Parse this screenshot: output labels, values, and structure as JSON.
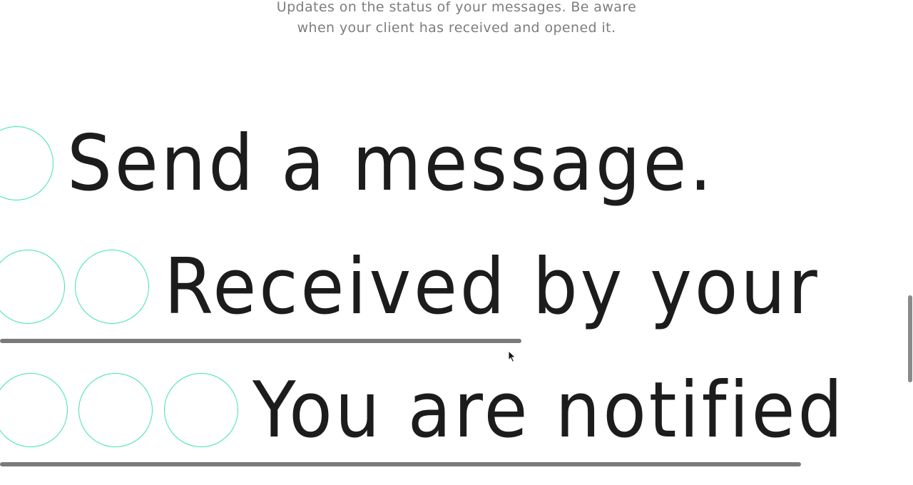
{
  "header": {
    "subtitle_line1": "Updates on the status of your messages. Be aware",
    "subtitle_line2": "when your client has received and opened it."
  },
  "steps": [
    {
      "label": "Send a message.",
      "ring_count": 1
    },
    {
      "label": "Received by your",
      "ring_count": 2
    },
    {
      "label": "You are notified",
      "ring_count": 3
    }
  ],
  "colors": {
    "ring": "#3fe2b6",
    "text": "#1c1c1c",
    "subtitle": "#7d7d7d",
    "line": "#7a7a7a"
  }
}
